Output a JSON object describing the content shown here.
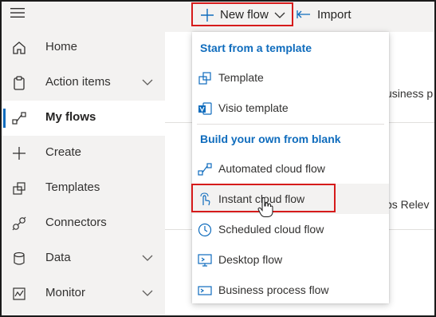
{
  "sidebar": {
    "items": [
      {
        "label": "Home",
        "icon": "home-icon",
        "has_chevron": false,
        "active": false
      },
      {
        "label": "Action items",
        "icon": "clipboard-icon",
        "has_chevron": true,
        "active": false
      },
      {
        "label": "My flows",
        "icon": "flow-icon",
        "has_chevron": false,
        "active": true
      },
      {
        "label": "Create",
        "icon": "plus-icon",
        "has_chevron": false,
        "active": false
      },
      {
        "label": "Templates",
        "icon": "templates-icon",
        "has_chevron": false,
        "active": false
      },
      {
        "label": "Connectors",
        "icon": "connector-icon",
        "has_chevron": false,
        "active": false
      },
      {
        "label": "Data",
        "icon": "database-icon",
        "has_chevron": true,
        "active": false
      },
      {
        "label": "Monitor",
        "icon": "monitor-icon",
        "has_chevron": true,
        "active": false
      }
    ]
  },
  "toolbar": {
    "new_flow_label": "New flow",
    "import_label": "Import"
  },
  "background": {
    "text_1": "usiness p",
    "text_2": "ps Relev"
  },
  "menu": {
    "section_template": "Start from a template",
    "section_blank": "Build your own from blank",
    "template_items": [
      {
        "label": "Template",
        "icon": "template-icon"
      },
      {
        "label": "Visio template",
        "icon": "visio-icon"
      }
    ],
    "blank_items": [
      {
        "label": "Automated cloud flow",
        "icon": "automated-flow-icon"
      },
      {
        "label": "Instant cloud flow",
        "icon": "instant-flow-icon"
      },
      {
        "label": "Scheduled cloud flow",
        "icon": "scheduled-flow-icon"
      },
      {
        "label": "Desktop flow",
        "icon": "desktop-flow-icon"
      },
      {
        "label": "Business process flow",
        "icon": "business-process-icon"
      }
    ]
  },
  "colors": {
    "accent": "#0f6cbd",
    "highlight_border": "#d61b1b",
    "sidebar_bg": "#f3f2f1"
  }
}
